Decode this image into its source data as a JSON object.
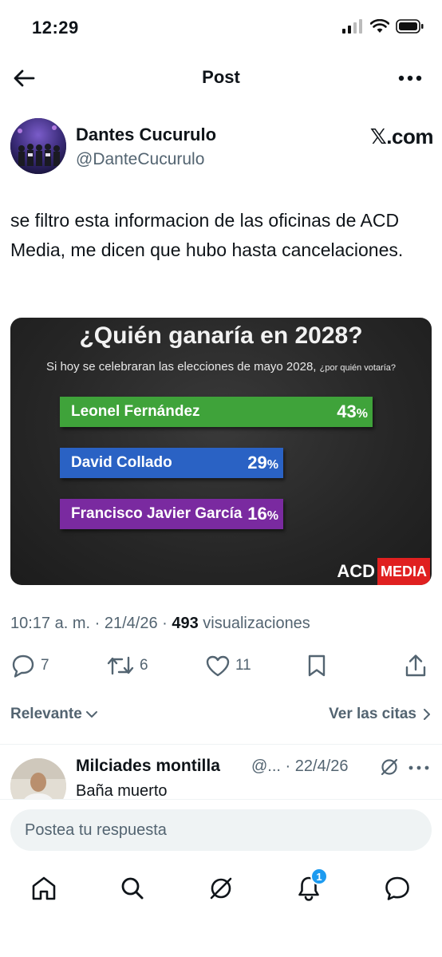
{
  "status_bar": {
    "time": "12:29"
  },
  "header": {
    "title": "Post"
  },
  "author": {
    "name": "Dantes Cucurulo",
    "handle": "@DanteCucurulo",
    "source": "𝕏.com"
  },
  "post": {
    "text": "se filtro esta informacion de las oficinas de ACD Media, me dicen que hubo hasta cancelaciones.",
    "timestamp_time": "10:17 a. m.",
    "timestamp_date": "21/4/26",
    "views_count": "493",
    "views_label": "visualizaciones"
  },
  "media": {
    "title": "¿Quién ganaría en 2028?",
    "subtitle": "Si hoy se celebraran las elecciones de mayo 2028,",
    "subtitle_question": "¿por quién votaría?",
    "logo_acd": "ACD",
    "logo_media": "MEDIA",
    "chart_data": {
      "type": "bar",
      "title": "¿Quién ganaría en 2028?",
      "categories": [
        "Leonel Fernández",
        "David Collado",
        "Francisco Javier García"
      ],
      "values": [
        43,
        29,
        16
      ],
      "value_labels": [
        "43",
        "29",
        "16"
      ],
      "unit": "%",
      "colors": [
        "#3fa33a",
        "#2a62c4",
        "#7a2aa0"
      ]
    }
  },
  "actions": {
    "replies": "7",
    "reposts": "6",
    "likes": "11"
  },
  "filters": {
    "relevance": "Relevante",
    "quotes": "Ver las citas"
  },
  "reply": {
    "name": "Milciades montilla",
    "handle": "@...",
    "date": "22/4/26",
    "text": "Baña muerto"
  },
  "compose": {
    "placeholder": "Postea tu respuesta"
  },
  "nav": {
    "notifications_badge": "1"
  }
}
